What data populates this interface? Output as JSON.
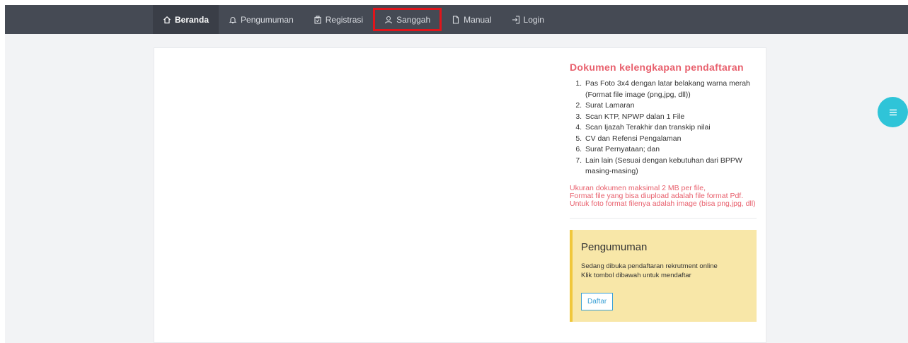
{
  "nav": {
    "items": [
      {
        "label": "Beranda",
        "icon": "home-icon"
      },
      {
        "label": "Pengumuman",
        "icon": "bell-icon"
      },
      {
        "label": "Registrasi",
        "icon": "clipboard-icon"
      },
      {
        "label": "Sanggah",
        "icon": "user-icon"
      },
      {
        "label": "Manual",
        "icon": "document-icon"
      },
      {
        "label": "Login",
        "icon": "login-icon"
      }
    ]
  },
  "docs": {
    "title": "Dokumen kelengkapan pendaftaran",
    "items": [
      "Pas Foto 3x4 dengan latar belakang warna merah (Format file image (png,jpg, dll))",
      "Surat Lamaran",
      "Scan KTP, NPWP dalan 1 File",
      "Scan Ijazah Terakhir dan transkip nilai",
      "CV dan Refensi Pengalaman",
      "Surat Pernyataan; dan",
      "Lain lain (Sesuai dengan kebutuhan dari BPPW masing-masing)"
    ],
    "notes": [
      "Ukuran dokumen maksimal 2 MB per file,",
      "Format file yang bisa diupload adalah file format Pdf.",
      "Untuk foto format filenya adalah image (bisa png,jpg, dll)"
    ]
  },
  "announcement": {
    "title": "Pengumuman",
    "lines": [
      "Sedang dibuka pendaftaran rekrutment online",
      "Klik tombol dibawah untuk mendaftar"
    ],
    "button_label": "Daftar"
  },
  "fab": {
    "icon": "menu-icon"
  },
  "colors": {
    "navbar": "#454a54",
    "accent_red": "#e8606d",
    "announce_bg": "#f8e7a8",
    "announce_border": "#f0c73a",
    "fab": "#2fc4d8",
    "highlight": "#e0151b",
    "link_blue": "#3aa0d5"
  }
}
